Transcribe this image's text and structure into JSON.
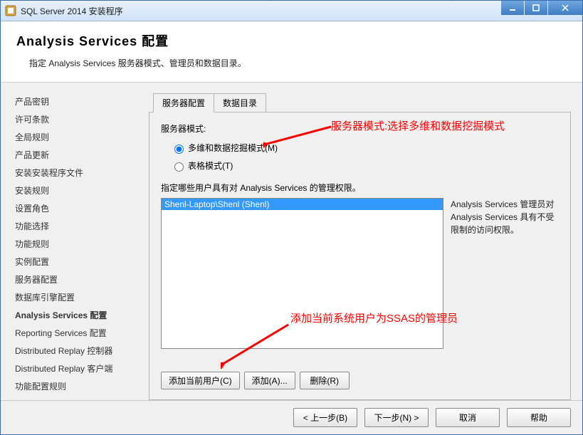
{
  "titlebar": {
    "title": "SQL Server 2014 安装程序"
  },
  "header": {
    "title": "Analysis  Services 配置",
    "subtitle": "指定 Analysis Services 服务器模式、管理员和数据目录。"
  },
  "sidebar": {
    "items": [
      "产品密钥",
      "许可条款",
      "全局规则",
      "产品更新",
      "安装安装程序文件",
      "安装规则",
      "设置角色",
      "功能选择",
      "功能规则",
      "实例配置",
      "服务器配置",
      "数据库引擎配置",
      "Analysis Services 配置",
      "Reporting Services 配置",
      "Distributed Replay 控制器",
      "Distributed Replay 客户端",
      "功能配置规则"
    ],
    "currentIndex": 12
  },
  "tabs": {
    "items": [
      "服务器配置",
      "数据目录"
    ],
    "activeIndex": 0
  },
  "serverMode": {
    "label": "服务器模式:",
    "options": {
      "multidim": "多维和数据挖掘模式(M)",
      "tabular": "表格模式(T)"
    },
    "selected": "multidim"
  },
  "permissions": {
    "label": "指定哪些用户具有对 Analysis Services 的管理权限。",
    "users": [
      "Shenl-Laptop\\Shenl (Shenl)"
    ],
    "description": "Analysis Services 管理员对 Analysis Services 具有不受限制的访问权限。"
  },
  "userButtons": {
    "addCurrent": "添加当前用户(C)",
    "add": "添加(A)...",
    "remove": "删除(R)"
  },
  "footer": {
    "back": "< 上一步(B)",
    "next": "下一步(N) >",
    "cancel": "取消",
    "help": "帮助"
  },
  "annotations": {
    "mode": "服务器模式:选择多维和数据挖掘模式",
    "admin": "添加当前系统用户为SSAS的管理员"
  }
}
